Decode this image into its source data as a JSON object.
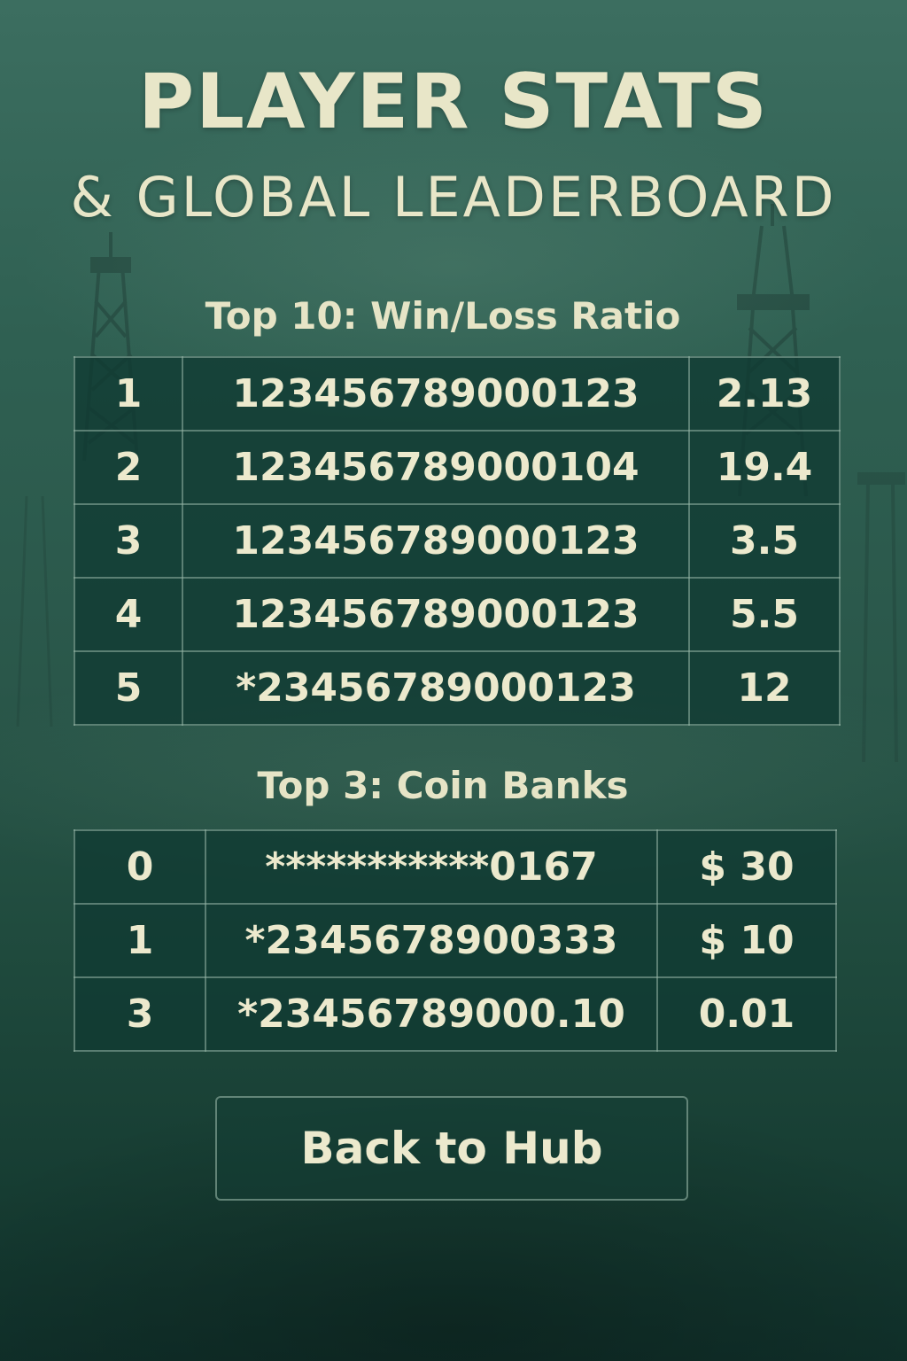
{
  "header": {
    "title": "PLAYER STATS",
    "subtitle": "& GLOBAL LEADERBOARD"
  },
  "winloss": {
    "heading": "Top 10: Win/Loss Ratio",
    "rows": [
      {
        "rank": "1",
        "player": "123456789000123",
        "value": "2.13"
      },
      {
        "rank": "2",
        "player": "123456789000104",
        "value": "19.4"
      },
      {
        "rank": "3",
        "player": "123456789000123",
        "value": "3.5"
      },
      {
        "rank": "4",
        "player": "123456789000123",
        "value": "5.5"
      },
      {
        "rank": "5",
        "player": "*23456789000123",
        "value": "12"
      }
    ]
  },
  "coins": {
    "heading": "Top 3: Coin Banks",
    "rows": [
      {
        "rank": "0",
        "player": "***********0167",
        "value": "$ 30"
      },
      {
        "rank": "1",
        "player": "*2345678900333",
        "value": "$ 10"
      },
      {
        "rank": "3",
        "player": "*23456789000.10",
        "value": "0.01"
      }
    ]
  },
  "actions": {
    "back_label": "Back to Hub"
  },
  "colors": {
    "background_top": "#3c6e60",
    "background_bottom": "#10302a",
    "text": "#e8e6c8",
    "table_fill": "#103a32",
    "border": "#96b4a5"
  }
}
